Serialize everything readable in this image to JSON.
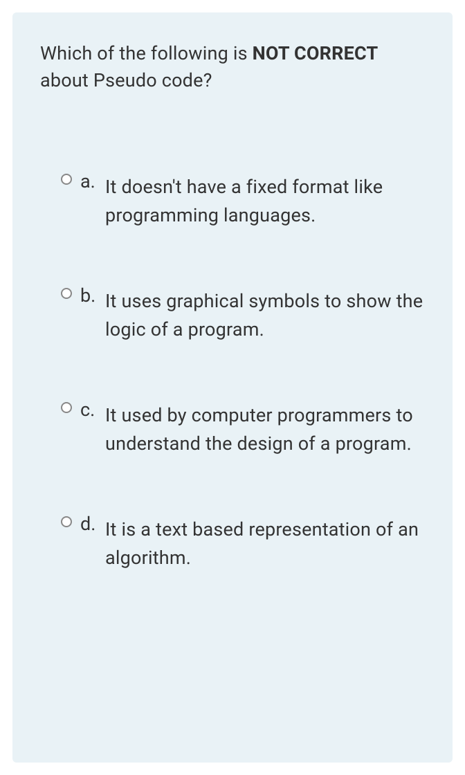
{
  "question": {
    "prefix": "Which of the following is ",
    "bold1": "NOT CORRECT",
    "suffix": " about Pseudo code?"
  },
  "options": [
    {
      "letter": "a.",
      "text": "It doesn't have a fixed format like programming languages."
    },
    {
      "letter": "b.",
      "text": "It uses graphical symbols to show the logic of a program."
    },
    {
      "letter": "c.",
      "text": "It used by computer programmers to understand the design of a program."
    },
    {
      "letter": "d.",
      "text": "It is a text based representation of an algorithm."
    }
  ]
}
